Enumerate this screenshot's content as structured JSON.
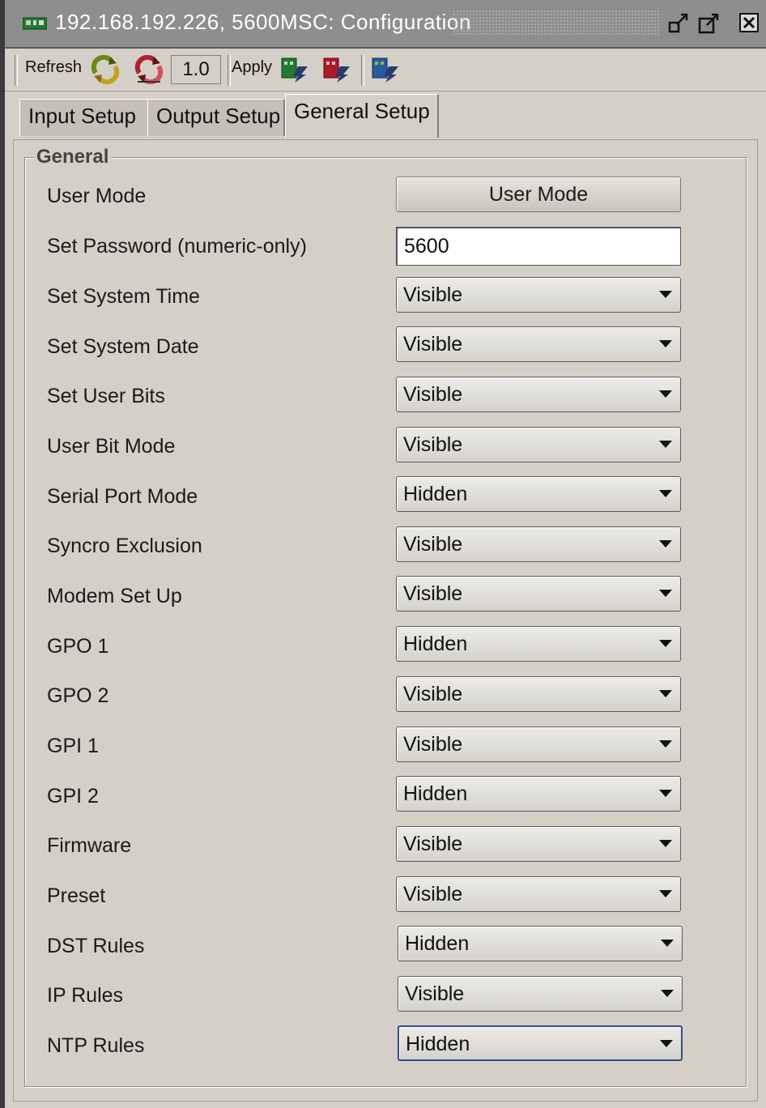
{
  "window": {
    "title": "192.168.192.226, 5600MSC: Configuration",
    "icons": [
      "app-card-icon",
      "undock-icon",
      "maximize-icon",
      "close-icon"
    ]
  },
  "toolbar": {
    "refresh_label": "Refresh",
    "version": "1.0",
    "apply_label": "Apply",
    "icons": [
      "refresh-green-icon",
      "refresh-red-icon",
      "apply-card-green-icon",
      "apply-card-red-icon",
      "apply-card-blue-icon"
    ]
  },
  "tabs": [
    {
      "label": "Input Setup",
      "active": false
    },
    {
      "label": "Output Setup",
      "active": false
    },
    {
      "label": "General Setup",
      "active": true
    }
  ],
  "general": {
    "group_title": "General",
    "user_mode": {
      "label": "User Mode",
      "button": "User Mode"
    },
    "password": {
      "label": "Set Password (numeric-only)",
      "value": "5600"
    },
    "settings": [
      {
        "label": "Set System Time",
        "value": "Visible"
      },
      {
        "label": "Set System Date",
        "value": "Visible"
      },
      {
        "label": "Set User Bits",
        "value": "Visible"
      },
      {
        "label": "User Bit Mode",
        "value": "Visible"
      },
      {
        "label": "Serial Port Mode",
        "value": "Hidden"
      },
      {
        "label": "Syncro Exclusion",
        "value": "Visible"
      },
      {
        "label": "Modem Set Up",
        "value": "Visible"
      },
      {
        "label": "GPO 1",
        "value": "Hidden"
      },
      {
        "label": "GPO 2",
        "value": "Visible"
      },
      {
        "label": "GPI 1",
        "value": "Visible"
      },
      {
        "label": "GPI 2",
        "value": "Hidden"
      },
      {
        "label": "Firmware",
        "value": "Visible"
      },
      {
        "label": "Preset",
        "value": "Visible"
      },
      {
        "label": "DST Rules",
        "value": "Hidden"
      },
      {
        "label": "IP Rules",
        "value": "Visible"
      },
      {
        "label": "NTP Rules",
        "value": "Hidden"
      }
    ]
  },
  "colors": {
    "background": "#d4d0c8",
    "titlebar": "#8e8e8e",
    "focus_border": "#3b4a8a"
  }
}
